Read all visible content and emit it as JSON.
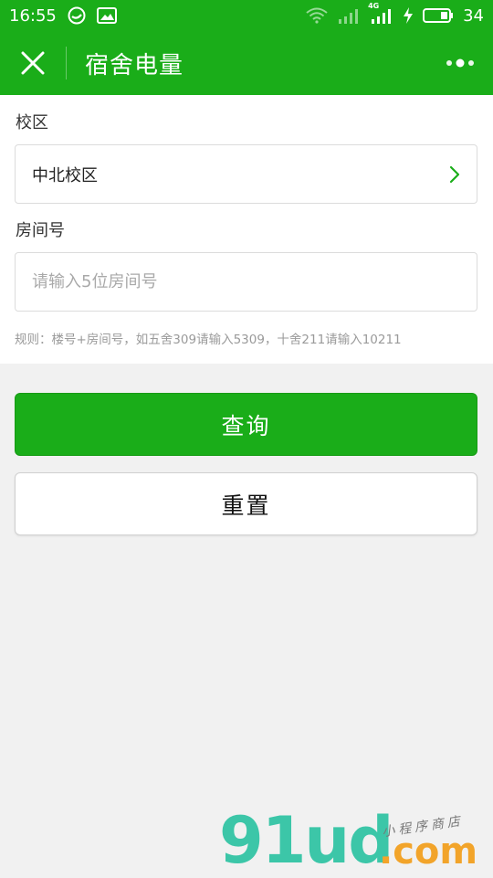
{
  "status_bar": {
    "time": "16:55",
    "battery": "34",
    "net_label": "4G"
  },
  "nav": {
    "title": "宿舍电量"
  },
  "form": {
    "campus_label": "校区",
    "campus_value": "中北校区",
    "room_label": "房间号",
    "room_value": "",
    "room_placeholder": "请输入5位房间号",
    "rule": "规则：楼号+房间号，如五舍309请输入5309，十舍211请输入10211"
  },
  "buttons": {
    "query_label": "查询",
    "reset_label": "重置"
  },
  "watermark": {
    "main": "91ud",
    "domain": ".com",
    "tagline": "小程序商店"
  },
  "colors": {
    "brand_green": "#1aad19",
    "background": "#f1f1f1",
    "watermark_teal": "#3cc6a8",
    "watermark_orange": "#f2a42a"
  }
}
